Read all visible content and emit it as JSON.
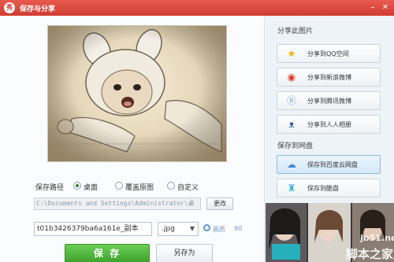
{
  "window": {
    "title": "保存与分享",
    "logo": "秀",
    "minimize_symbol": "–",
    "close_symbol": "✕"
  },
  "save_options": {
    "path_label": "保存路径",
    "radio_desktop": "桌面",
    "radio_overwrite": "覆盖原图",
    "radio_custom": "自定义",
    "selected": "桌面",
    "path_value": "C:\\Documents and Settings\\Administrator\\桌",
    "change_button": "更改",
    "filename_value": "t01b3426379ba6a161e_副本",
    "extension_value": ".jpg",
    "dropdown_arrow": "▼",
    "quality_label": "画质",
    "quality_value": "90",
    "save_button": "保 存",
    "save_as_button": "另存为"
  },
  "share_panel": {
    "share_photo_header": "分享此图片",
    "buttons": [
      {
        "label": "分享到QQ空间",
        "icon": "qzone-star-icon",
        "glyph": "★",
        "color": "#f0b400"
      },
      {
        "label": "分享到新浪微博",
        "icon": "sina-weibo-icon",
        "glyph": "◉",
        "color": "#e0332a"
      },
      {
        "label": "分享到腾讯微博",
        "icon": "tencent-weibo-icon",
        "glyph": "ⓟ",
        "color": "#5aa4dc"
      },
      {
        "label": "分享到人人相册",
        "icon": "renren-icon",
        "glyph": "ᴥ",
        "color": "#2a5a9c"
      }
    ],
    "cloud_header": "保存到网盘",
    "cloud_buttons": [
      {
        "label": "保存到百度云网盘",
        "icon": "baidu-cloud-icon",
        "glyph": "☁",
        "color": "#3f86d8",
        "active": true
      },
      {
        "label": "保存到酷盘",
        "icon": "kuaipan-icon",
        "glyph": "♜",
        "color": "#38b8d6",
        "active": false
      }
    ]
  },
  "watermark": {
    "url": "jb51.net",
    "site": "脚本之家"
  }
}
